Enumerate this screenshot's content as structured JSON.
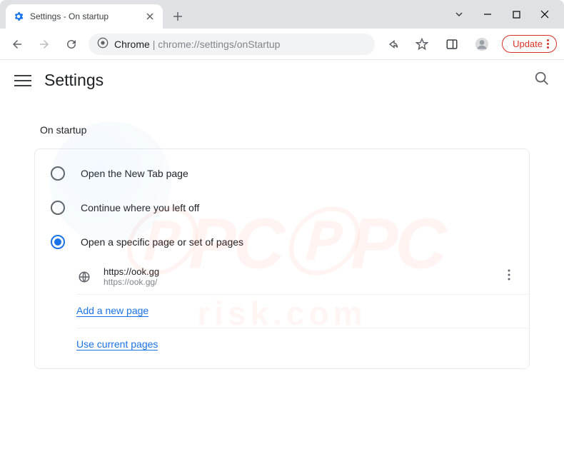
{
  "window": {
    "tab_title": "Settings - On startup"
  },
  "urlbar": {
    "label": "Chrome",
    "path": "chrome://settings/onStartup",
    "update_label": "Update"
  },
  "header": {
    "title": "Settings"
  },
  "section": {
    "title": "On startup",
    "options": [
      {
        "label": "Open the New Tab page",
        "selected": false
      },
      {
        "label": "Continue where you left off",
        "selected": false
      },
      {
        "label": "Open a specific page or set of pages",
        "selected": true
      }
    ],
    "page": {
      "title": "https://ook.gg",
      "url": "https://ook.gg/"
    },
    "add_link": "Add a new page",
    "use_link": "Use current pages"
  }
}
